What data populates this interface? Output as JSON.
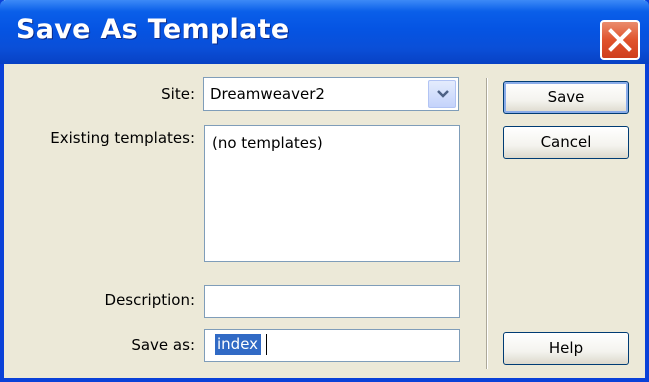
{
  "window": {
    "title": "Save As Template"
  },
  "form": {
    "site_label": "Site:",
    "site_value": "Dreamweaver2",
    "existing_label": "Existing templates:",
    "existing_items": [
      "(no templates)"
    ],
    "description_label": "Description:",
    "description_value": "",
    "saveas_label": "Save as:",
    "saveas_value": "index"
  },
  "buttons": {
    "save": "Save",
    "cancel": "Cancel",
    "help": "Help"
  },
  "icons": {
    "close": "close-icon",
    "dropdown": "chevron-down-icon"
  },
  "colors": {
    "titlebar": "#0554e3",
    "close": "#e0532c",
    "selection": "#316ac5",
    "dialog_bg": "#ece9d8"
  }
}
